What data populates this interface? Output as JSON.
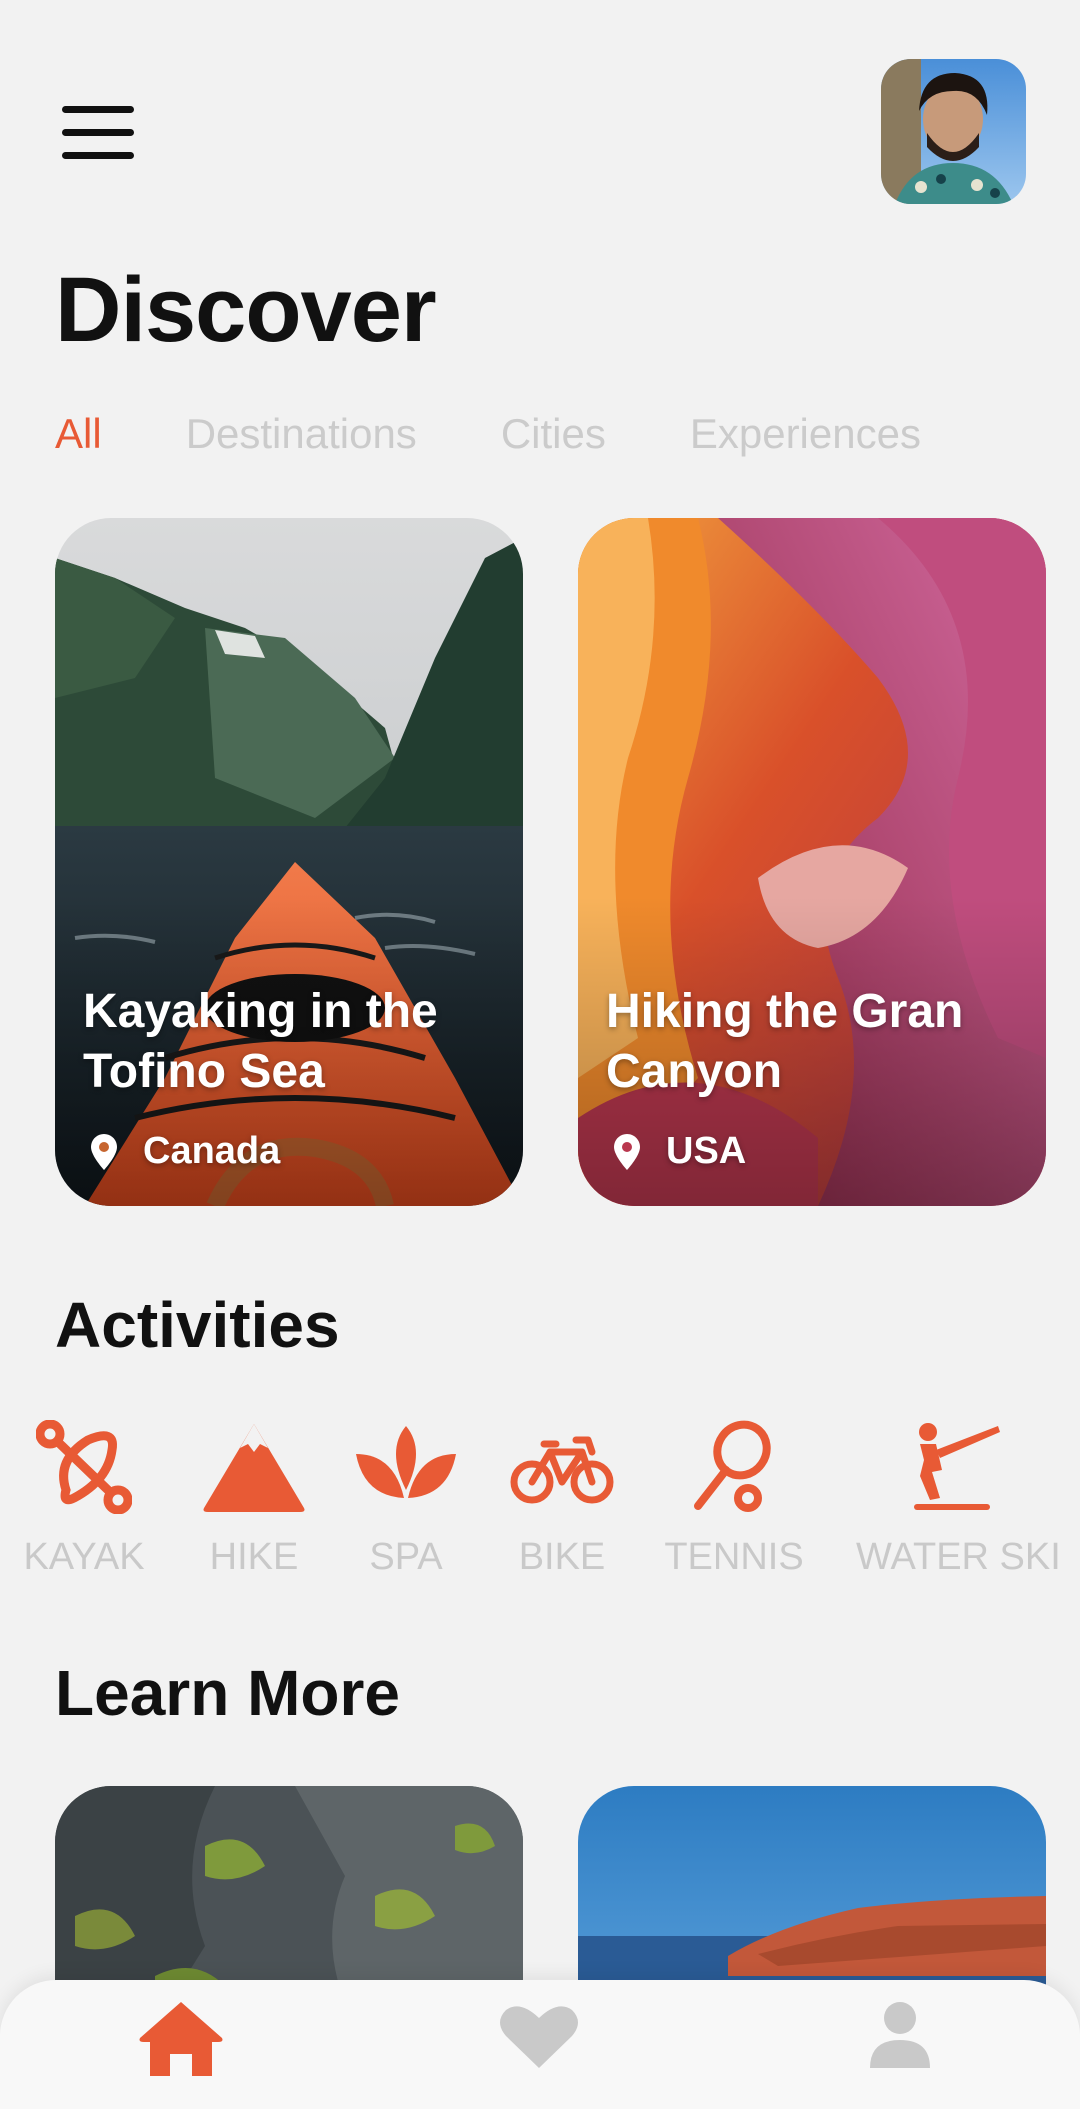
{
  "header": {
    "menu_icon": "hamburger-menu-icon",
    "avatar": "user-profile-photo"
  },
  "page": {
    "title": "Discover"
  },
  "tabs": [
    {
      "label": "All",
      "active": true
    },
    {
      "label": "Destinations",
      "active": false
    },
    {
      "label": "Cities",
      "active": false
    },
    {
      "label": "Experiences",
      "active": false
    }
  ],
  "cards": [
    {
      "title": "Kayaking in the Tofino Sea",
      "location": "Canada",
      "location_icon": "map-pin-icon"
    },
    {
      "title": "Hiking the Gran Canyon",
      "location": "USA",
      "location_icon": "map-pin-icon"
    }
  ],
  "activities": {
    "title": "Activities",
    "items": [
      {
        "label": "KAYAK",
        "icon": "kayak-icon"
      },
      {
        "label": "HIKE",
        "icon": "mountain-icon"
      },
      {
        "label": "SPA",
        "icon": "lotus-icon"
      },
      {
        "label": "BIKE",
        "icon": "bike-icon"
      },
      {
        "label": "TENNIS",
        "icon": "tennis-racket-icon"
      },
      {
        "label": "WATER SKI",
        "icon": "water-ski-icon"
      }
    ]
  },
  "learn_more": {
    "title": "Learn More"
  },
  "bottom_nav": {
    "items": [
      {
        "icon": "home-icon",
        "active": true
      },
      {
        "icon": "heart-icon",
        "active": false
      },
      {
        "icon": "user-icon",
        "active": false
      }
    ]
  },
  "colors": {
    "accent": "#e85a35",
    "inactive": "#c9c9c9",
    "background": "#f2f2f2"
  }
}
